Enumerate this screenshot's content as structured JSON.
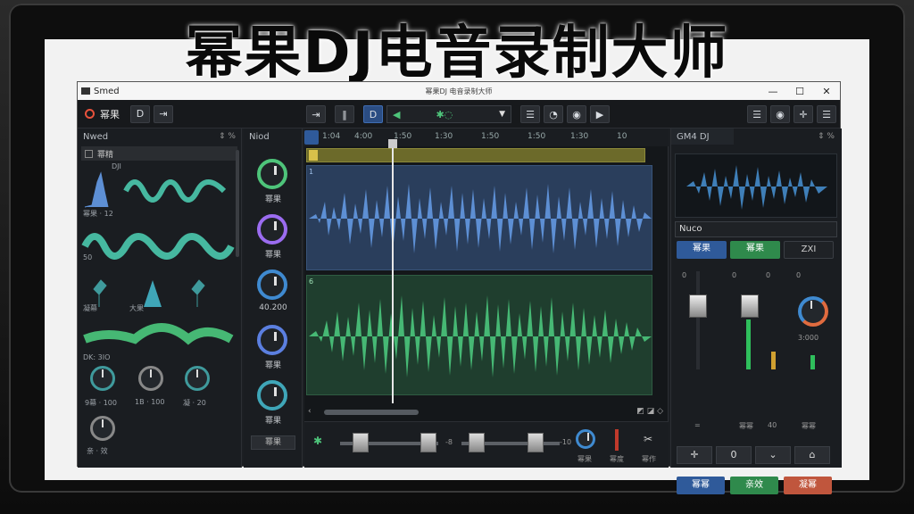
{
  "headline": "幂果DJ电音录制大师",
  "window": {
    "app_name": "Smed",
    "center_title": "幂果DJ 电音录制大师",
    "controls": [
      "—",
      "☐",
      "✕"
    ]
  },
  "toolbar": {
    "brand": "幂果",
    "left_buttons": [
      "D",
      "⇥"
    ],
    "transport": [
      "⇥",
      "‖",
      "D"
    ],
    "track_select_value": "✱◌",
    "extra_buttons": [
      "☰",
      "◔",
      "◉",
      "▶"
    ],
    "right_buttons": [
      "☰",
      "◉",
      "✛",
      "☰"
    ]
  },
  "library": {
    "title": "Nwed",
    "item_head": "幂精",
    "labels": [
      "DJI",
      "幂果 · 12",
      "50",
      "凝幕",
      "大果",
      "DK: 3IO",
      "9幕 · 100",
      "1B · 100",
      "凝 · 20",
      "亲 · 效"
    ]
  },
  "effects": {
    "title": "Niod",
    "knobs": [
      {
        "label": "幂果",
        "color": "#4ec47a"
      },
      {
        "label": "幂果",
        "color": "#9b6cf0"
      },
      {
        "label": "40.200",
        "color": "#3f8ad0"
      },
      {
        "label": "幂果",
        "color": "#5b7fe0"
      },
      {
        "label": "幂果",
        "color": "#3fa6b8"
      }
    ],
    "footer_button": "幂果"
  },
  "timeline": {
    "ruler_ticks": [
      "1:04",
      "4:00",
      "1:50",
      "1:30",
      "1:50",
      "1:50",
      "1:30",
      "1:50",
      "10"
    ],
    "loop_label": "0",
    "track1_label": "1",
    "track2_label": "6",
    "mixer_labels": [
      "-8",
      "-10",
      "幂果",
      "幂度",
      "幂作"
    ]
  },
  "right_panel": {
    "title": "GM4 DJ",
    "preset": "Nuco",
    "tabs": [
      "幂果",
      "幂果",
      "ZXI"
    ],
    "fader_labels": [
      "0",
      "0",
      "0",
      "0"
    ],
    "bottom_labels": [
      "=",
      "幂幂",
      "40",
      "幂幂"
    ],
    "knob_value": "3:000",
    "icon_buttons": [
      "✛",
      "0",
      "⌄",
      "⌂"
    ],
    "action_buttons": [
      "幂幂",
      "亲效",
      "凝幂"
    ]
  },
  "colors": {
    "accent_blue": "#2b4d83",
    "wave_blue": "#5d8fd4",
    "wave_green": "#46b874",
    "danger": "#c0563d"
  }
}
